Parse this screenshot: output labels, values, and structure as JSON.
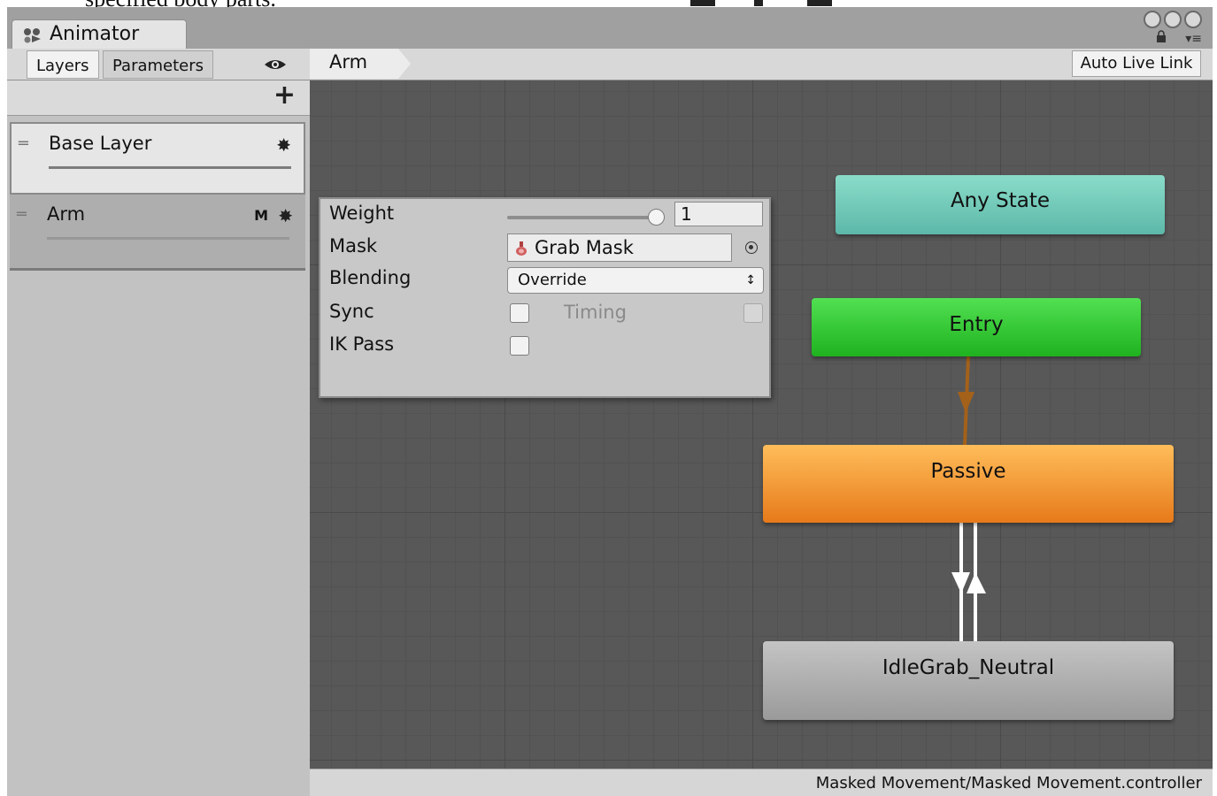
{
  "document": {
    "caption_fragment": "specified body parts."
  },
  "window": {
    "tab_title": "Animator",
    "icons": [
      "animator-icon",
      "window-circle-icons",
      "lock-icon",
      "panel-menu-icon"
    ]
  },
  "toolbar": {
    "tabs": [
      {
        "label": "Layers",
        "active": true
      },
      {
        "label": "Parameters",
        "active": false
      }
    ],
    "breadcrumb": "Arm",
    "auto_live_link": "Auto Live Link"
  },
  "layers": [
    {
      "name": "Base Layer",
      "selected": true,
      "flags": ""
    },
    {
      "name": "Arm",
      "selected": false,
      "flags": "M"
    }
  ],
  "layer_settings": {
    "weight_label": "Weight",
    "weight_value": "1",
    "weight_fraction": 1,
    "mask_label": "Mask",
    "mask_value": "Grab Mask",
    "blending_label": "Blending",
    "blending_value": "Override",
    "sync_label": "Sync",
    "sync_checked": false,
    "timing_label": "Timing",
    "timing_checked": false,
    "ik_pass_label": "IK Pass",
    "ik_pass_checked": false
  },
  "states": {
    "any_state": "Any State",
    "entry": "Entry",
    "passive": "Passive",
    "idle": "IdleGrab_Neutral"
  },
  "colors": {
    "any_state": "#6cc7b5",
    "entry": "#2ac62b",
    "passive": "#f39b33",
    "idle": "#b0b0b0",
    "entry_transition": "#a4611a",
    "graph_bg": "#585858"
  },
  "status": {
    "path": "Masked Movement/Masked Movement.controller"
  }
}
